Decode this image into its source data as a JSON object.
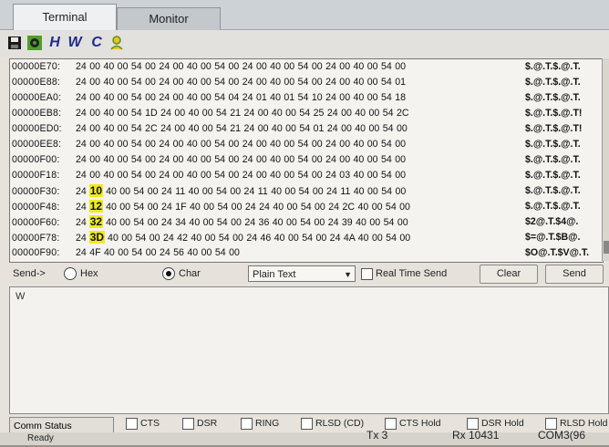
{
  "tabs": [
    {
      "label": "Terminal",
      "active": true
    },
    {
      "label": "Monitor",
      "active": false
    }
  ],
  "toolbar": {
    "icons": [
      "save-icon",
      "settings-gear-icon",
      "hex-h-icon",
      "w-icon",
      "c-icon",
      "clear-icon"
    ],
    "h_label": "H",
    "w_label": "W",
    "c_label": "C"
  },
  "hex_rows": [
    {
      "addr": "00000E70:",
      "bytes": "24 00 40 00 54 00 24 00 40 00 54 00 24 00 40 00 54 00 24 00 40 00 54 00",
      "ascii": "$.@.T.$.@.T."
    },
    {
      "addr": "00000E88:",
      "bytes": "24 00 40 00 54 00 24 00 40 00 54 00 24 00 40 00 54 00 24 00 40 00 54 01",
      "ascii": "$.@.T.$.@.T."
    },
    {
      "addr": "00000EA0:",
      "bytes": "24 00 40 00 54 00 24 00 40 00 54 04 24 01 40 01 54 10 24 00 40 00 54 18",
      "ascii": "$.@.T.$.@.T."
    },
    {
      "addr": "00000EB8:",
      "bytes": "24 00 40 00 54 1D 24 00 40 00 54 21 24 00 40 00 54 25 24 00 40 00 54 2C",
      "ascii": "$.@.T.$.@.T!"
    },
    {
      "addr": "00000ED0:",
      "bytes": "24 00 40 00 54 2C 24 00 40 00 54 21 24 00 40 00 54 01 24 00 40 00 54 00",
      "ascii": "$.@.T.$.@.T!"
    },
    {
      "addr": "00000EE8:",
      "bytes": "24 00 40 00 54 00 24 00 40 00 54 00 24 00 40 00 54 00 24 00 40 00 54 00",
      "ascii": "$.@.T.$.@.T."
    },
    {
      "addr": "00000F00:",
      "bytes": "24 00 40 00 54 00 24 00 40 00 54 00 24 00 40 00 54 00 24 00 40 00 54 00",
      "ascii": "$.@.T.$.@.T."
    },
    {
      "addr": "00000F18:",
      "bytes": "24 00 40 00 54 00 24 00 40 00 54 00 24 00 40 00 54 00 24 03 40 00 54 00",
      "ascii": "$.@.T.$.@.T."
    },
    {
      "addr": "00000F30:",
      "pre": "24",
      "hl": "10",
      "bytes": "40 00 54 00 24 11 40 00 54 00 24 11 40 00 54 00 24 11 40 00 54 00",
      "ascii": "$.@.T.$.@.T."
    },
    {
      "addr": "00000F48:",
      "pre": "24",
      "hl": "12",
      "bytes": "40 00 54 00 24 1F 40 00 54 00 24 24 40 00 54 00 24 2C 40 00 54 00",
      "ascii": "$.@.T.$.@.T."
    },
    {
      "addr": "00000F60:",
      "pre": "24",
      "hl": "32",
      "bytes": "40 00 54 00 24 34 40 00 54 00 24 36 40 00 54 00 24 39 40 00 54 00",
      "ascii": "$2@.T.$4@."
    },
    {
      "addr": "00000F78:",
      "pre": "24",
      "hl": "3D",
      "bytes": "40 00 54 00 24 42 40 00 54 00 24 46 40 00 54 00 24 4A 40 00 54 00",
      "ascii": "$=@.T.$B@."
    },
    {
      "addr": "00000F90:",
      "bytes": "24 4F 40 00 54 00 24 56 40 00 54 00",
      "ascii": "$O@.T.$V@.T."
    }
  ],
  "send_bar": {
    "send_label": "Send->",
    "hex_label": "Hex",
    "char_label": "Char",
    "mode_value": "Plain Text",
    "realtime_label": "Real Time Send",
    "clear_label": "Clear",
    "send_button": "Send",
    "selected_radio": "Char"
  },
  "input_text": "W",
  "status": {
    "comm_status": "Comm Status",
    "indicators": [
      "CTS",
      "DSR",
      "RING",
      "RLSD (CD)",
      "CTS Hold",
      "DSR Hold",
      "RLSD Hold"
    ]
  },
  "bottom": {
    "ready": "Ready",
    "tx": "Tx 3",
    "rx": "Rx 10431",
    "port": "COM3(96"
  },
  "colors": {
    "highlight": "#f0ea1e",
    "window_bg": "#e7e3dc"
  }
}
